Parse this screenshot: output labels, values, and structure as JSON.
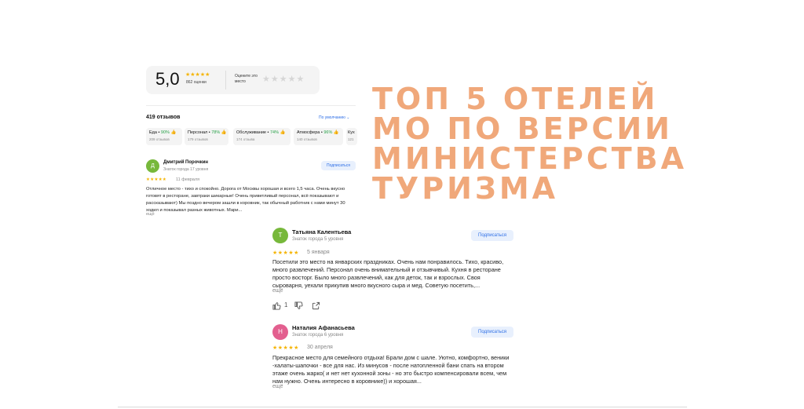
{
  "rating": {
    "score": "5,0",
    "stars": "★★★★★",
    "count": "862 оценки",
    "rate_prompt": "Оцените это место",
    "rate_stars": "★★★★★"
  },
  "reviews_header": {
    "count": "419 отзывов",
    "sort": "По умолчанию ⌄"
  },
  "categories": [
    {
      "name": "Еда",
      "pct": "90%",
      "sub": "209 отзывов"
    },
    {
      "name": "Персонал",
      "pct": "78%",
      "sub": "179 отзывов"
    },
    {
      "name": "Обслуживание",
      "pct": "74%",
      "sub": "174 отзыва"
    },
    {
      "name": "Атмосфера",
      "pct": "96%",
      "sub": "140 отзывов"
    },
    {
      "name": "Кух",
      "pct": "",
      "sub": "121"
    }
  ],
  "reviews": [
    {
      "initial": "Д",
      "author": "Дмитрий Порочкин",
      "level": "Знаток города 17 уровня",
      "subscribe": "Подписаться",
      "stars": "★★★★★",
      "date": "11 февраля",
      "text": "Отличное место - тихо и спокойно. Дорога от Москвы хорошая и всего 1,5 часа. Очень вкусно готовят в ресторане, завтраки шикарные! Очень приветливый персонал, всё показывают и рассказывают) Мы поздно вечером зашли в коровник, так обычный работник с нами минут 30 ходил и показывал разных животных. Мари...",
      "more": "ещё"
    },
    {
      "initial": "Т",
      "author": "Татьяна Калентьева",
      "level": "Знаток города 5 уровня",
      "subscribe": "Подписаться",
      "stars": "★★★★★",
      "date": "5 января",
      "text": "Посетили это место на январских праздниках. Очень нам понравилось. Тихо, красиво, много развлечений. Персонал очень внимательный и отзывчивый. Кухня в ресторане просто восторг. Было много развлечений, как для деток, так и взрослых. Своя сыроварня, уехали прикупив много вкусного сыра и мед. Советую посетить,...",
      "more": "ещё",
      "likes": "1"
    },
    {
      "initial": "Н",
      "author": "Наталия Афанасьева",
      "level": "Знаток города 6 уровня",
      "subscribe": "Подписаться",
      "stars": "★★★★★",
      "date": "30 апреля",
      "text": "Прекрасное место для семейного отдыха! Брали дом с шале. Уютно, комфортно, веники -халаты-шапочки - все для нас. Из минусов - после натопленной бани спать на втором этаже очень жарко( и нет нет кухонной зоны - но это быстро компенсировали всем, чем нам нужно. Очень интересно в коровнике)) и хорошая...",
      "more": "ещё"
    }
  ],
  "headline": {
    "line1": "ТОП 5 ОТЕЛЕЙ",
    "line2": "МО ПО ВЕРСИИ",
    "line3": "МИНИСТЕРСТВА",
    "line4": "ТУРИЗМА"
  },
  "colors": {
    "headline": "#f0a87a",
    "star": "#f5b400",
    "link": "#2d6ee6",
    "positive": "#2aa24a"
  }
}
